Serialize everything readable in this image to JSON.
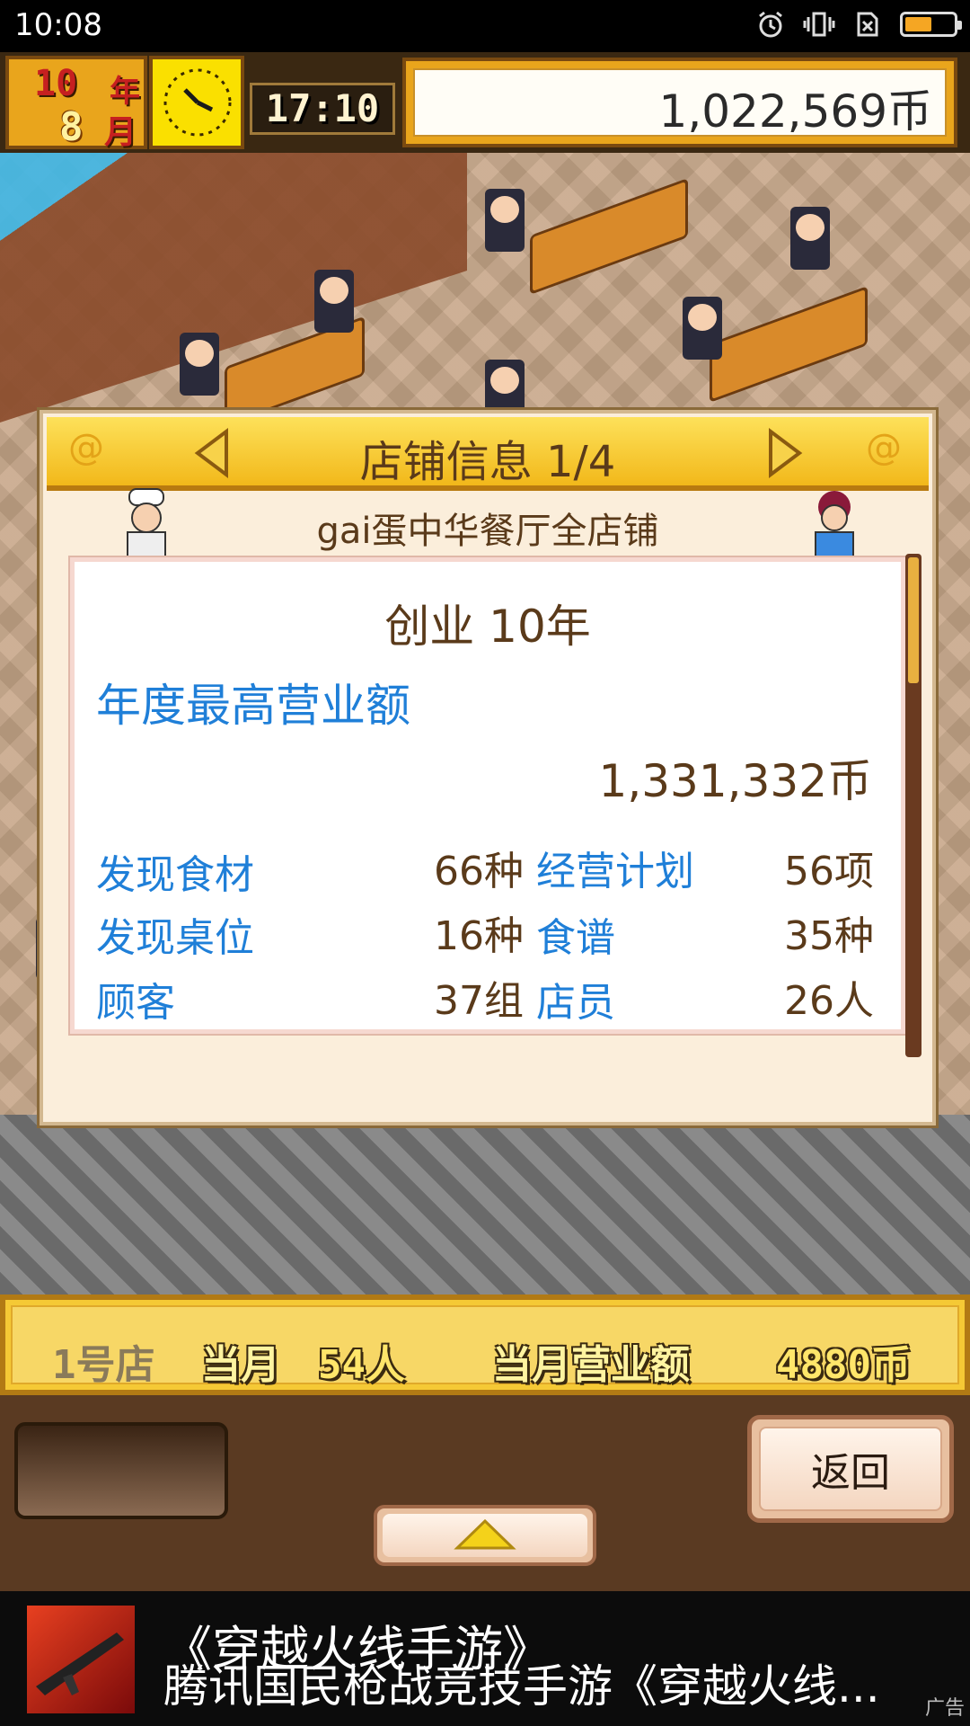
{
  "status_bar": {
    "time": "10:08",
    "icons": [
      "alarm-icon",
      "vibrate-icon",
      "no-sim-icon",
      "battery-icon"
    ],
    "battery_level": 0.55
  },
  "hud": {
    "year_num": "10",
    "year_label": "年",
    "month_num": "8",
    "month_label": "月",
    "game_time": "17:10",
    "money": "1,022,569币"
  },
  "modal": {
    "title": "店铺信息 1/4",
    "subtitle": "gai蛋中华餐厅全店铺",
    "founding": "创业 10年",
    "best_label": "年度最高营业额",
    "best_value": "1,331,332币",
    "stats": [
      {
        "label": "发现食材",
        "value": "66种"
      },
      {
        "label": "经营计划",
        "value": "56项"
      },
      {
        "label": "发现桌位",
        "value": "16种"
      },
      {
        "label": "食谱",
        "value": "35种"
      },
      {
        "label": "顾客",
        "value": "37组"
      },
      {
        "label": "店员",
        "value": "26人"
      }
    ]
  },
  "bottom_bar": {
    "store": "1号店",
    "month_tag": "当月",
    "customers": "54人",
    "sales_tag": "当月营业额",
    "sales_value": "4880币"
  },
  "controls": {
    "return_label": "返回"
  },
  "ad": {
    "title": "《穿越火线手游》",
    "description": "腾讯国民枪战竞技手游《穿越火线...",
    "mark": "广告"
  },
  "colors": {
    "accent_gold": "#f2b81a",
    "label_blue": "#1f7fd8",
    "text_brown": "#5a3a1a"
  }
}
